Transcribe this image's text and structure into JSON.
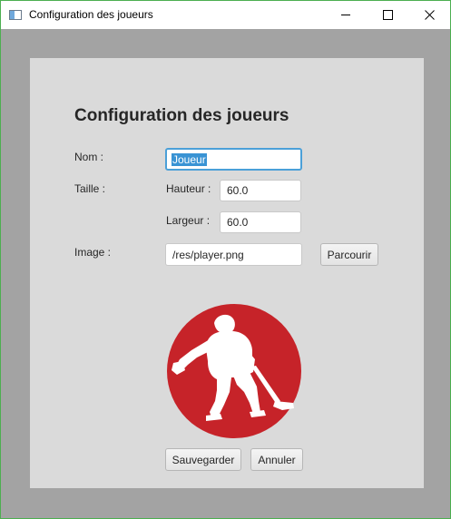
{
  "window": {
    "title": "Configuration des joueurs",
    "icon": "app-window-icon",
    "controls": [
      "minimize-icon",
      "maximize-icon",
      "close-icon"
    ]
  },
  "form": {
    "heading": "Configuration des joueurs",
    "name_label": "Nom :",
    "name_value": "Joueur",
    "size_label": "Taille :",
    "height_label": "Hauteur :",
    "height_value": "60.0",
    "width_label": "Largeur :",
    "width_value": "60.0",
    "image_label": "Image :",
    "image_path": "/res/player.png",
    "browse_label": "Parcourir",
    "image_preview": "hockey-player-icon",
    "save_label": "Sauvegarder",
    "cancel_label": "Annuler"
  },
  "colors": {
    "accent": "#4ba0d8",
    "selection": "#3993d4",
    "preview_circle": "#c62329",
    "window_border": "#4caf50"
  }
}
